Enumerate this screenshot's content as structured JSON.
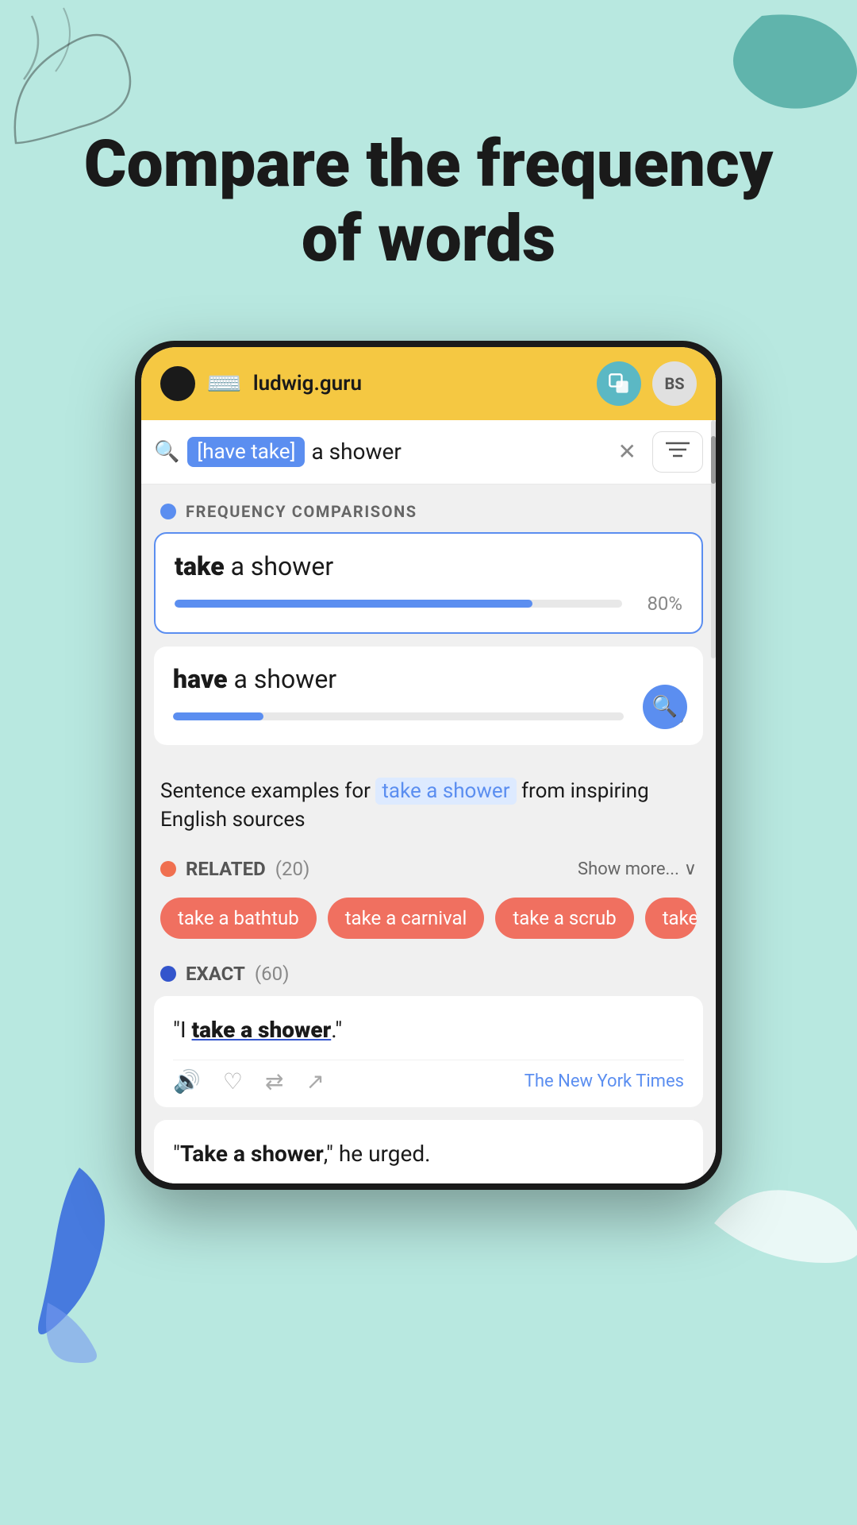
{
  "page": {
    "background_color": "#b8e8e0",
    "headline": "Compare the frequency of words"
  },
  "browser": {
    "url": "ludwig.guru",
    "cam_icon": "⬤",
    "typewriter_icon": "⌨",
    "copy_btn_label": "📋",
    "user_btn_label": "BS"
  },
  "search": {
    "placeholder": "[have take] a shower",
    "highlight_text": "[have take]",
    "plain_text": "a shower",
    "filter_icon": "≡"
  },
  "frequency_section": {
    "label": "FREQUENCY COMPARISONS",
    "items": [
      {
        "word": "take",
        "rest": " a shower",
        "percent": 80,
        "percent_label": "80%",
        "active": true
      },
      {
        "word": "have",
        "rest": " a shower",
        "percent": 20,
        "percent_label": "20%",
        "active": false
      }
    ]
  },
  "sentence_section": {
    "prefix": "Sentence examples for ",
    "highlight": "take a shower",
    "suffix": " from inspiring English sources"
  },
  "related": {
    "label": "RELATED",
    "count": "(20)",
    "show_more": "Show more...",
    "tags": [
      "take a bathtub",
      "take a carnival",
      "take a scrub",
      "take a wa..."
    ]
  },
  "exact": {
    "label": "EXACT",
    "count": "(60)"
  },
  "examples": [
    {
      "text_before": "\"I ",
      "bold": "take a shower",
      "text_after": ".",
      "closing_quote": "\"",
      "source": "The New York Times",
      "actions": [
        "🔊",
        "♡",
        "⇄",
        "↗"
      ]
    },
    {
      "text_before": "\"",
      "bold": "Take a shower",
      "text_after": ",\" he urged."
    }
  ],
  "icons": {
    "search": "🔍",
    "close": "✕",
    "filter": "⊟",
    "speaker": "🔊",
    "heart": "♡",
    "retweet": "⇄",
    "share": "↗",
    "chevron_down": "∨"
  }
}
